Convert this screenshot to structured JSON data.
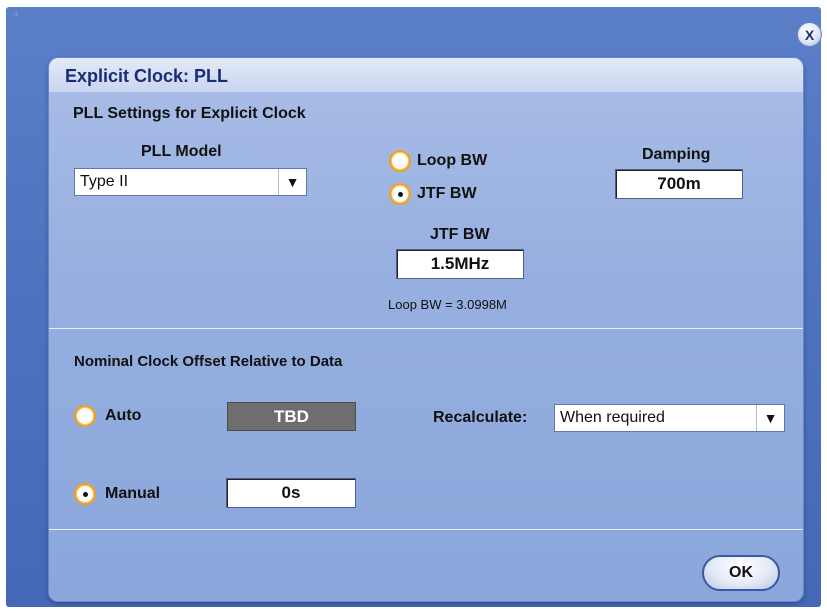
{
  "window": {
    "close_label": "X"
  },
  "dialog": {
    "title": "Explicit Clock: PLL",
    "pll_section": {
      "heading": "PLL Settings for Explicit Clock",
      "model_label": "PLL Model",
      "model_value": "Type II",
      "bw_options": [
        {
          "label": "Loop BW",
          "selected": false
        },
        {
          "label": "JTF BW",
          "selected": true
        }
      ],
      "jtf_bw_label": "JTF BW",
      "jtf_bw_value": "1.5MHz",
      "loop_bw_note": "Loop BW = 3.0998M",
      "damping_label": "Damping",
      "damping_value": "700m"
    },
    "offset_section": {
      "heading": "Nominal Clock Offset Relative to Data",
      "auto_label": "Auto",
      "auto_selected": false,
      "auto_value": "TBD",
      "manual_label": "Manual",
      "manual_selected": true,
      "manual_value": "0s",
      "recalculate_label": "Recalculate:",
      "recalculate_value": "When required"
    },
    "ok_label": "OK"
  },
  "colors": {
    "background": "#4e73c0",
    "dialog_panel": "#97afe0",
    "title_text": "#1c2a78",
    "radio_ring": "#f0a020",
    "readonly_box": "#6e6e6e"
  },
  "icons": {
    "close": "close-x-icon",
    "dropdown": "triangle-down-icon"
  }
}
